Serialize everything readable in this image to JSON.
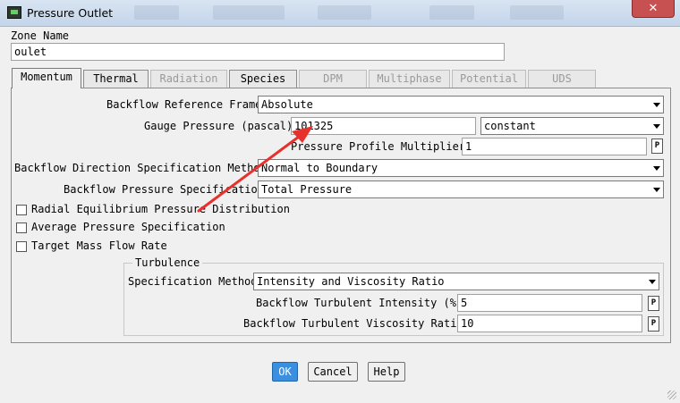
{
  "window": {
    "title": "Pressure Outlet"
  },
  "zone": {
    "label": "Zone Name",
    "value": "oulet"
  },
  "tabs": [
    {
      "label": "Momentum",
      "active": true,
      "enabled": true
    },
    {
      "label": "Thermal",
      "active": false,
      "enabled": true
    },
    {
      "label": "Radiation",
      "active": false,
      "enabled": false
    },
    {
      "label": "Species",
      "active": false,
      "enabled": true
    },
    {
      "label": "DPM",
      "active": false,
      "enabled": false
    },
    {
      "label": "Multiphase",
      "active": false,
      "enabled": false
    },
    {
      "label": "Potential",
      "active": false,
      "enabled": false
    },
    {
      "label": "UDS",
      "active": false,
      "enabled": false
    }
  ],
  "momentum": {
    "backflow_reference_frame": {
      "label": "Backflow Reference Frame",
      "value": "Absolute"
    },
    "gauge_pressure": {
      "label": "Gauge Pressure (pascal)",
      "value": "101325",
      "method": "constant"
    },
    "profile_multiplier": {
      "label": "Pressure Profile Multiplier",
      "value": "1",
      "p_label": "P"
    },
    "direction_method": {
      "label": "Backflow Direction Specification Method",
      "value": "Normal to Boundary"
    },
    "backflow_pressure_spec": {
      "label": "Backflow Pressure Specification",
      "value": "Total Pressure"
    },
    "checkboxes": [
      {
        "label": "Radial Equilibrium Pressure Distribution",
        "checked": false
      },
      {
        "label": "Average Pressure Specification",
        "checked": false
      },
      {
        "label": "Target Mass Flow Rate",
        "checked": false
      }
    ]
  },
  "turbulence": {
    "legend": "Turbulence",
    "spec_method": {
      "label": "Specification Method",
      "value": "Intensity and Viscosity Ratio"
    },
    "intensity": {
      "label": "Backflow Turbulent Intensity (%)",
      "value": "5",
      "p_label": "P"
    },
    "viscosity_ratio": {
      "label": "Backflow Turbulent Viscosity Ratio",
      "value": "10",
      "p_label": "P"
    }
  },
  "buttons": {
    "ok": "OK",
    "cancel": "Cancel",
    "help": "Help"
  },
  "colors": {
    "annotation_arrow": "#e8312a",
    "ok_button": "#3b8fe0",
    "close_button": "#c75050"
  },
  "icons": {
    "close": "close-icon",
    "app": "fluent-app-icon",
    "dropdown": "chevron-down-icon"
  }
}
